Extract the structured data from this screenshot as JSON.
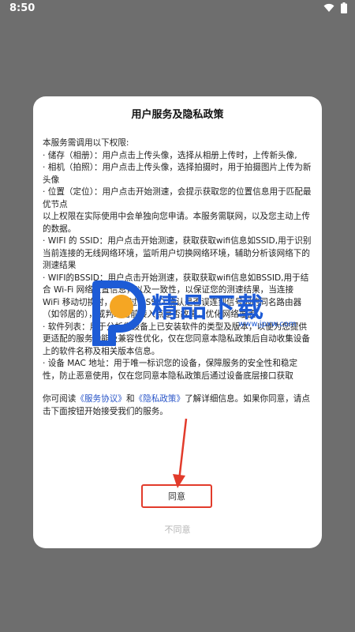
{
  "status_bar": {
    "time": "8:50",
    "icons": [
      "wifi-icon",
      "battery-icon"
    ]
  },
  "dialog": {
    "title": "用户服务及隐私政策",
    "paragraphs": [
      "本服务需调用以下权限:",
      "· 储存（相册）：用户点击上传头像，选择从相册上传时，上传新头像,",
      "· 相机（拍照）：用户点击上传头像，选择拍摄时，用于拍摄图片上传为新头像",
      "· 位置（定位）：用户点击开始测速，会提示获取您的位置信息用于匹配最优节点",
      "以上权限在实际使用中会单独向您申请。本服务需联网，以及您主动上传的数据。",
      "· WIFI 的 SSID：用户点击开始测速，获取获取wifi信息如SSID,用于识别当前连接的无线网络环境，监听用户切换网络环境，辅助分析该网络下的测速结果",
      "· WIFI的BSSID：用户点击开始测速，获取获取wifi信息如BSSID,用于结合 Wi-Fi 网络位置信息，以及一致性，以保证您的测速结果，当连接 WiFi 移动切换时，可通过 BSSID 确认是否误连到信号弱的同名路由器（如邻居的），或判断当前接入点是否故障，优化网络覆盖。",
      "· 软件列表：用于分析您设备上已安装软件的类型及版本，以便为您提供更适配的服务功能及兼容性优化，仅在您同意本隐私政策后自动收集设备上的软件名称及相关版本信息。",
      "· 设备 MAC 地址：用于唯一标识您的设备，保障服务的安全性和稳定性，防止恶意使用，仅在您同意本隐私政策后通过设备底层接口获取"
    ],
    "read_prefix": "你可阅读",
    "link_service": "《服务协议》",
    "read_and": "和",
    "link_privacy": "《隐私政策》",
    "read_suffix": "了解详细信息。如果你同意，请点击下面按钮开始接受我们的服务。",
    "agree_label": "同意",
    "disagree_label": "不同意"
  },
  "watermark": {
    "text": "精品下载",
    "url": "www.jpxw.com"
  },
  "colors": {
    "overlay": "#6e6e6e",
    "dialog_bg": "#ffffff",
    "link": "#2a56c8",
    "annotation": "#e23b2b",
    "watermark": "#1d5bd6"
  }
}
